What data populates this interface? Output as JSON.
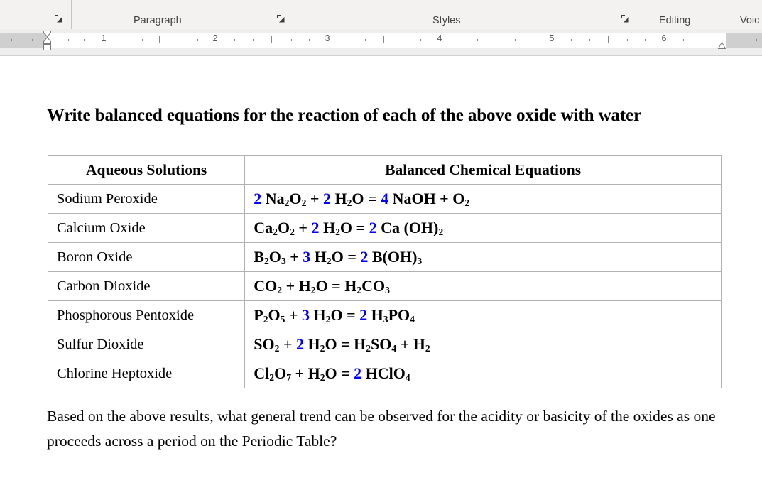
{
  "ribbon": {
    "groups": [
      {
        "label": "Paragraph",
        "launcher_icon": "dialog-launcher-icon"
      },
      {
        "label": "Styles",
        "launcher_icon": "dialog-launcher-icon"
      },
      {
        "label": "Editing",
        "launcher_icon": "dialog-launcher-icon"
      },
      {
        "label": "Voic",
        "launcher_icon": null
      }
    ]
  },
  "ruler": {
    "unit_labels": [
      "1",
      "2",
      "3",
      "4",
      "5",
      "6"
    ],
    "left_indent_marker": "first-line-indent-marker",
    "hanging_indent_marker": "hanging-indent-marker",
    "left_margin_marker": "left-indent-marker",
    "right_indent_marker": "right-indent-marker"
  },
  "document": {
    "heading": "Write balanced equations for the reaction of each of the above oxide with water",
    "table": {
      "headers": [
        "Aqueous Solutions",
        "Balanced Chemical Equations"
      ],
      "rows": [
        {
          "name": "Sodium Peroxide",
          "equation_parts": [
            {
              "t": "2",
              "blue": true
            },
            {
              "t": " Na"
            },
            {
              "t": "2",
              "sub": true
            },
            {
              "t": "O"
            },
            {
              "t": "2",
              "sub": true
            },
            {
              "t": " + "
            },
            {
              "t": "2",
              "blue": true
            },
            {
              "t": " H"
            },
            {
              "t": "2",
              "sub": true
            },
            {
              "t": "O = "
            },
            {
              "t": "4",
              "blue": true
            },
            {
              "t": " NaOH + O"
            },
            {
              "t": "2",
              "sub": true
            }
          ]
        },
        {
          "name": "Calcium Oxide",
          "equation_parts": [
            {
              "t": "Ca"
            },
            {
              "t": "2",
              "sub": true
            },
            {
              "t": "O"
            },
            {
              "t": "2",
              "sub": true
            },
            {
              "t": " + "
            },
            {
              "t": "2",
              "blue": true
            },
            {
              "t": " H"
            },
            {
              "t": "2",
              "sub": true
            },
            {
              "t": "O = "
            },
            {
              "t": "2",
              "blue": true
            },
            {
              "t": " Ca (OH)"
            },
            {
              "t": "2",
              "sub": true
            }
          ]
        },
        {
          "name": "Boron Oxide",
          "equation_parts": [
            {
              "t": "B"
            },
            {
              "t": "2",
              "sub": true
            },
            {
              "t": "O"
            },
            {
              "t": "3",
              "sub": true
            },
            {
              "t": " + "
            },
            {
              "t": "3",
              "blue": true
            },
            {
              "t": " H"
            },
            {
              "t": "2",
              "sub": true
            },
            {
              "t": "O = "
            },
            {
              "t": "2",
              "blue": true
            },
            {
              "t": " B(OH)"
            },
            {
              "t": "3",
              "sub": true
            }
          ]
        },
        {
          "name": "Carbon Dioxide",
          "equation_parts": [
            {
              "t": "CO"
            },
            {
              "t": "2",
              "sub": true
            },
            {
              "t": " + H"
            },
            {
              "t": "2",
              "sub": true
            },
            {
              "t": "O = H"
            },
            {
              "t": "2",
              "sub": true
            },
            {
              "t": "CO"
            },
            {
              "t": "3",
              "sub": true
            }
          ]
        },
        {
          "name": "Phosphorous Pentoxide",
          "equation_parts": [
            {
              "t": "P"
            },
            {
              "t": "2",
              "sub": true
            },
            {
              "t": "O"
            },
            {
              "t": "5",
              "sub": true
            },
            {
              "t": " + "
            },
            {
              "t": "3",
              "blue": true
            },
            {
              "t": " H"
            },
            {
              "t": "2",
              "sub": true
            },
            {
              "t": "O = "
            },
            {
              "t": "2",
              "blue": true
            },
            {
              "t": " H"
            },
            {
              "t": "3",
              "sub": true
            },
            {
              "t": "PO"
            },
            {
              "t": "4",
              "sub": true
            }
          ]
        },
        {
          "name": "Sulfur Dioxide",
          "equation_parts": [
            {
              "t": "SO"
            },
            {
              "t": "2",
              "sub": true
            },
            {
              "t": " + "
            },
            {
              "t": "2",
              "blue": true
            },
            {
              "t": " H"
            },
            {
              "t": "2",
              "sub": true
            },
            {
              "t": "O = H"
            },
            {
              "t": "2",
              "sub": true
            },
            {
              "t": "SO"
            },
            {
              "t": "4",
              "sub": true
            },
            {
              "t": " + H"
            },
            {
              "t": "2",
              "sub": true
            }
          ]
        },
        {
          "name": "Chlorine Heptoxide",
          "equation_parts": [
            {
              "t": "Cl"
            },
            {
              "t": "2",
              "sub": true
            },
            {
              "t": "O"
            },
            {
              "t": "7",
              "sub": true
            },
            {
              "t": " + H"
            },
            {
              "t": "2",
              "sub": true
            },
            {
              "t": "O = "
            },
            {
              "t": "2",
              "blue": true
            },
            {
              "t": " HClO"
            },
            {
              "t": "4",
              "sub": true
            }
          ]
        }
      ]
    },
    "paragraph": "Based on the above results, what general trend can be observed for the acidity or basicity of the oxides as one proceeds across a period on the Periodic Table?"
  },
  "colors": {
    "coefficient_blue": "#0000FF",
    "text_black": "#000000",
    "table_border": "#B2B2B2",
    "ribbon_bg": "#F3F2F1"
  }
}
